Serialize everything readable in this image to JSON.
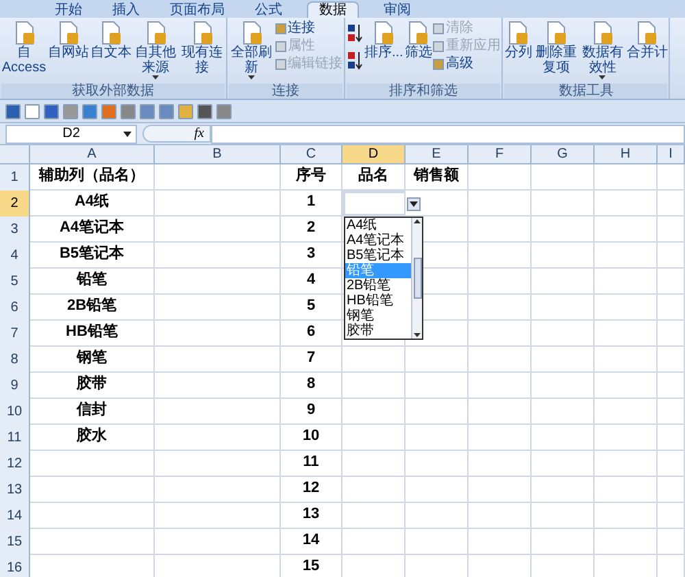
{
  "ribbon_tabs": [
    {
      "label": "开始",
      "selected": false
    },
    {
      "label": "插入",
      "selected": false
    },
    {
      "label": "页面布局",
      "selected": false
    },
    {
      "label": "公式",
      "selected": false
    },
    {
      "label": "数据",
      "selected": true
    },
    {
      "label": "审阅",
      "selected": false
    }
  ],
  "ribbon_groups": [
    {
      "title": "获取外部数据",
      "columns": [
        {
          "kind": "large",
          "label": "自 Access",
          "caret": false
        },
        {
          "kind": "large",
          "label": "自网站",
          "caret": false
        },
        {
          "kind": "large",
          "label": "自文本",
          "caret": false
        },
        {
          "kind": "large",
          "label": "自其他来源",
          "caret": true
        },
        {
          "kind": "large",
          "label": "现有连接",
          "caret": false
        }
      ]
    },
    {
      "title": "连接",
      "columns": [
        {
          "kind": "large",
          "label": "全部刷新",
          "caret": true
        },
        {
          "kind": "stack",
          "items": [
            {
              "label": "连接",
              "disabled": false
            },
            {
              "label": "属性",
              "disabled": true
            },
            {
              "label": "编辑链接",
              "disabled": true
            }
          ]
        }
      ]
    },
    {
      "title": "排序和筛选",
      "columns": [
        {
          "kind": "sort_icons"
        },
        {
          "kind": "large",
          "label": "排序...",
          "caret": false
        },
        {
          "kind": "large",
          "label": "筛选",
          "caret": false
        },
        {
          "kind": "stack",
          "items": [
            {
              "label": "清除",
              "disabled": true
            },
            {
              "label": "重新应用",
              "disabled": true
            },
            {
              "label": "高级",
              "disabled": false
            }
          ]
        }
      ]
    },
    {
      "title": "数据工具",
      "columns": [
        {
          "kind": "large",
          "label": "分列",
          "caret": false
        },
        {
          "kind": "large",
          "label": "删除重复项",
          "caret": false
        },
        {
          "kind": "large",
          "label": "数据有效性",
          "caret": true
        },
        {
          "kind": "large",
          "label": "合并计",
          "caret": false
        }
      ]
    }
  ],
  "name_box": "D2",
  "formula_label": "fx",
  "columns": [
    {
      "label": "A",
      "selected": false
    },
    {
      "label": "B",
      "selected": false
    },
    {
      "label": "C",
      "selected": false
    },
    {
      "label": "D",
      "selected": true
    },
    {
      "label": "E",
      "selected": false
    },
    {
      "label": "F",
      "selected": false
    },
    {
      "label": "G",
      "selected": false
    },
    {
      "label": "H",
      "selected": false
    },
    {
      "label": "I",
      "selected": false
    }
  ],
  "rows": [
    {
      "number": "1",
      "selected": false,
      "cells": [
        "辅助列（品名）",
        "",
        "序号",
        "品名",
        "销售额"
      ]
    },
    {
      "number": "2",
      "selected": true,
      "cells": [
        "A4纸",
        "",
        "1",
        "",
        ""
      ]
    },
    {
      "number": "3",
      "selected": false,
      "cells": [
        "A4笔记本",
        "",
        "2",
        "",
        ""
      ]
    },
    {
      "number": "4",
      "selected": false,
      "cells": [
        "B5笔记本",
        "",
        "3",
        "",
        ""
      ]
    },
    {
      "number": "5",
      "selected": false,
      "cells": [
        "铅笔",
        "",
        "4",
        "",
        ""
      ]
    },
    {
      "number": "6",
      "selected": false,
      "cells": [
        "2B铅笔",
        "",
        "5",
        "",
        ""
      ]
    },
    {
      "number": "7",
      "selected": false,
      "cells": [
        "HB铅笔",
        "",
        "6",
        "",
        ""
      ]
    },
    {
      "number": "8",
      "selected": false,
      "cells": [
        "钢笔",
        "",
        "7",
        "",
        ""
      ]
    },
    {
      "number": "9",
      "selected": false,
      "cells": [
        "胶带",
        "",
        "8",
        "",
        ""
      ]
    },
    {
      "number": "10",
      "selected": false,
      "cells": [
        "信封",
        "",
        "9",
        "",
        ""
      ]
    },
    {
      "number": "11",
      "selected": false,
      "cells": [
        "胶水",
        "",
        "10",
        "",
        ""
      ]
    },
    {
      "number": "12",
      "selected": false,
      "cells": [
        "",
        "",
        "11",
        "",
        ""
      ]
    },
    {
      "number": "13",
      "selected": false,
      "cells": [
        "",
        "",
        "12",
        "",
        ""
      ]
    },
    {
      "number": "14",
      "selected": false,
      "cells": [
        "",
        "",
        "13",
        "",
        ""
      ]
    },
    {
      "number": "15",
      "selected": false,
      "cells": [
        "",
        "",
        "14",
        "",
        ""
      ]
    },
    {
      "number": "16",
      "selected": false,
      "cells": [
        "",
        "",
        "15",
        "",
        ""
      ]
    }
  ],
  "dropdown": {
    "items": [
      {
        "label": "A4纸",
        "selected": false
      },
      {
        "label": "A4笔记本",
        "selected": false
      },
      {
        "label": "B5笔记本",
        "selected": false
      },
      {
        "label": "铅笔",
        "selected": true
      },
      {
        "label": "2B铅笔",
        "selected": false
      },
      {
        "label": "HB铅笔",
        "selected": false
      },
      {
        "label": "钢笔",
        "selected": false
      },
      {
        "label": "胶带",
        "selected": false
      }
    ]
  }
}
